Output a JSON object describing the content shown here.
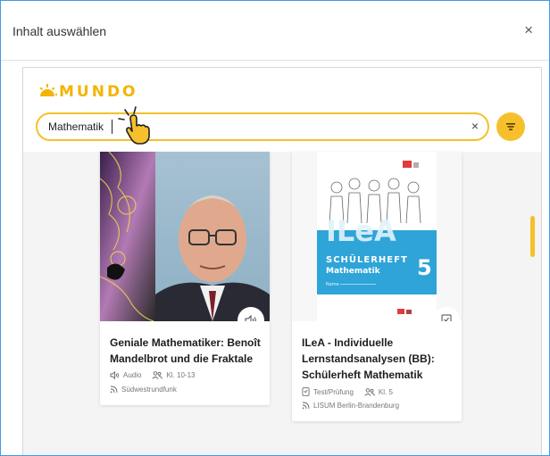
{
  "dialog": {
    "title": "Inhalt auswählen",
    "close_label": "×"
  },
  "brand": {
    "name": "MUNDO",
    "color": "#f3b400"
  },
  "search": {
    "value": "Mathematik",
    "clear_label": "×"
  },
  "colors": {
    "accent": "#f5c02c",
    "dialog_border": "#3d9be9",
    "ilea_blue": "#2fa4d8"
  },
  "cards": [
    {
      "title": "Geniale Mathematiker: Benoît Mandelbrot und die Fraktale",
      "type": "Audio",
      "type_icon": "speaker-icon",
      "grade": "Kl. 10-13",
      "publisher": "Südwestrundfunk"
    },
    {
      "title": "ILeA - Individuelle Lernstandsanalysen (BB): Schülerheft Mathematik",
      "type": "Test/Prüfung",
      "type_icon": "checklist-icon",
      "grade": "Kl. 5",
      "publisher": "LISUM Berlin-Brandenburg",
      "cover": {
        "logo": "ILeA",
        "heading": "SCHÜLERHEFT",
        "subject": "Mathematik",
        "grade_number": "5",
        "name_label": "Name"
      }
    }
  ]
}
